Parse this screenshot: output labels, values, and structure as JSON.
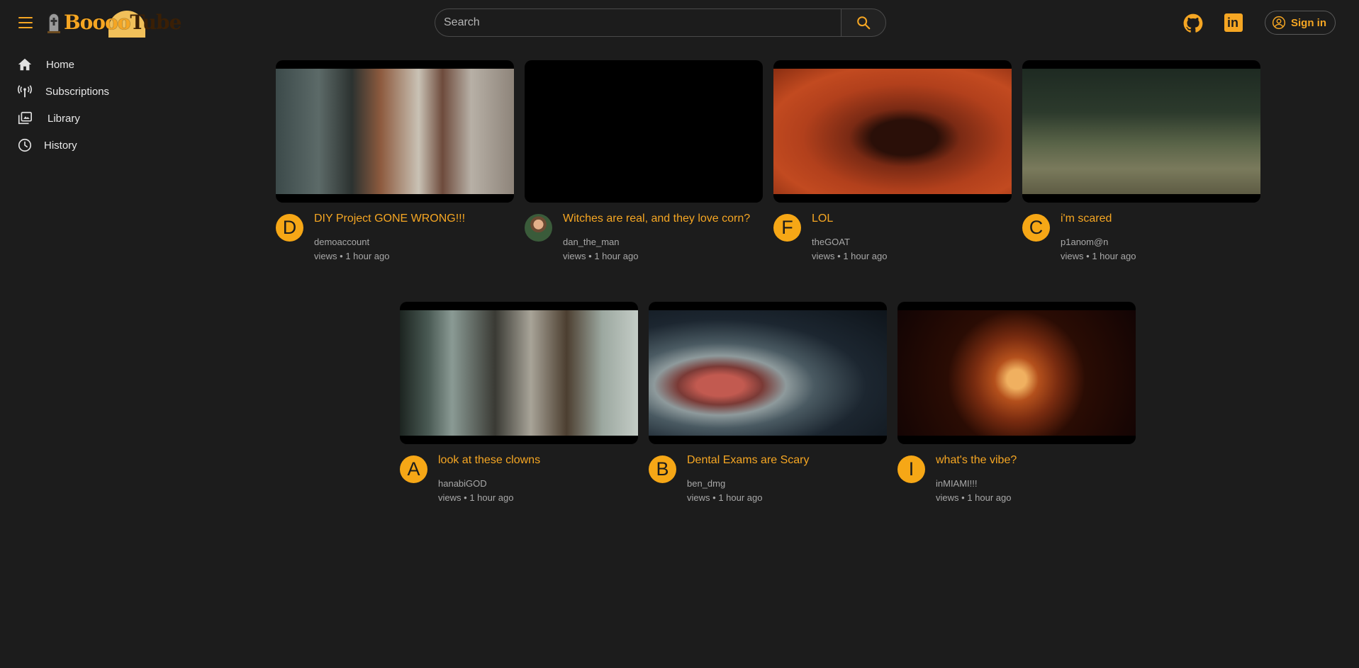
{
  "header": {
    "logo_text_a": "Boooo",
    "logo_text_b": "Tube",
    "search_placeholder": "Search",
    "signin_label": "Sign in",
    "linkedin_glyph": "in"
  },
  "sidebar": {
    "items": [
      {
        "label": "Home",
        "icon": "home-icon"
      },
      {
        "label": "Subscriptions",
        "icon": "subscriptions-icon"
      },
      {
        "label": "Library",
        "icon": "library-icon"
      },
      {
        "label": "History",
        "icon": "history-icon"
      }
    ]
  },
  "colors": {
    "accent": "#f5a623",
    "background": "#1c1c1c",
    "muted_text": "#a8a8a8"
  },
  "videos": [
    {
      "title": "DIY Project GONE WRONG!!!",
      "channel": "demoaccount",
      "views": "views",
      "age": "1 hour ago",
      "avatar": "D"
    },
    {
      "title": "Witches are real, and they love corn?",
      "channel": "dan_the_man",
      "views": "views",
      "age": "1 hour ago",
      "avatar": ""
    },
    {
      "title": "LOL",
      "channel": "theGOAT",
      "views": "views",
      "age": "1 hour ago",
      "avatar": "F"
    },
    {
      "title": "i'm scared",
      "channel": "p1anom@n",
      "views": "views",
      "age": "1 hour ago",
      "avatar": "C"
    },
    {
      "title": "look at these clowns",
      "channel": "hanabiGOD",
      "views": "views",
      "age": "1 hour ago",
      "avatar": "A"
    },
    {
      "title": "Dental Exams are Scary",
      "channel": "ben_dmg",
      "views": "views",
      "age": "1 hour ago",
      "avatar": "B"
    },
    {
      "title": "what's the vibe?",
      "channel": "inMIAMI!!!",
      "views": "views",
      "age": "1 hour ago",
      "avatar": "I"
    }
  ],
  "stats_separator": "•"
}
